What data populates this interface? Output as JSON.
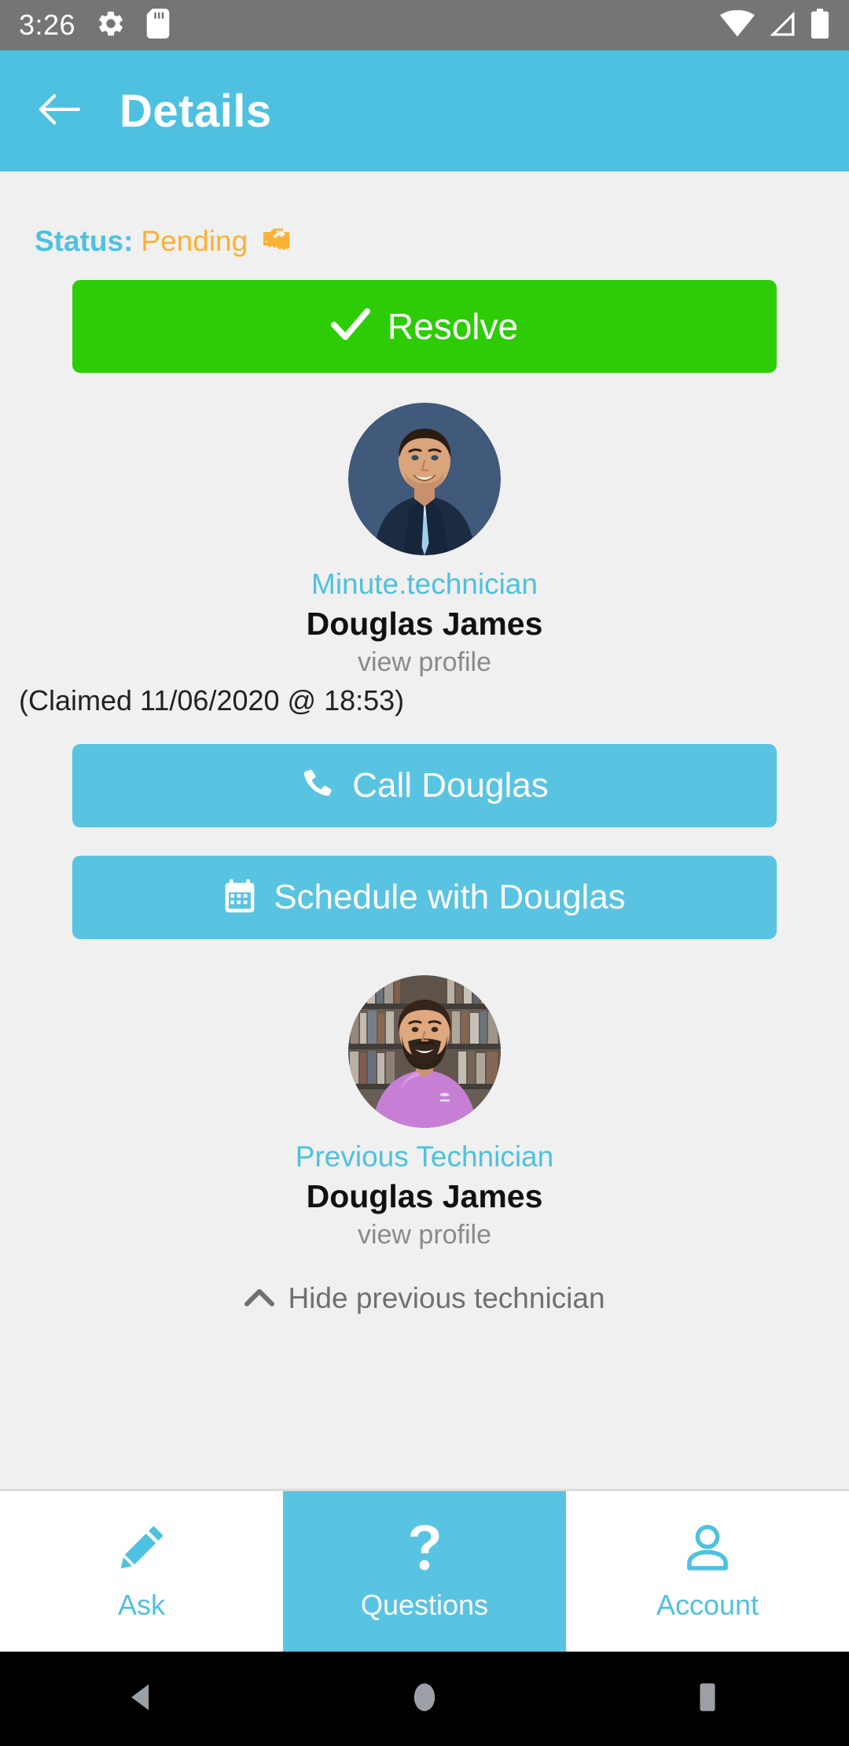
{
  "status_bar": {
    "time": "3:26",
    "left_icons": [
      "gear-icon",
      "sd-card-icon"
    ],
    "right_icons": [
      "wifi-icon",
      "cellular-signal-icon",
      "battery-icon"
    ]
  },
  "header": {
    "title": "Details",
    "back_icon": "arrow-left-icon",
    "background_color": "#4ec1e0"
  },
  "ticket": {
    "status_label": "Status:",
    "status_value": "Pending",
    "status_icon": "handshake-icon",
    "status_label_color": "#4ec1e0",
    "status_value_color": "#f9b233"
  },
  "resolve_button": {
    "label": "Resolve",
    "icon": "check-icon",
    "color": "#2ecc06"
  },
  "current_technician": {
    "role": "Minute.technician",
    "name": "Douglas James",
    "view_profile": "view profile",
    "claimed": "(Claimed 11/06/2020 @ 18:53)",
    "avatar": "avatar-man-in-navy-suit"
  },
  "actions": {
    "call": {
      "label": "Call Douglas",
      "icon": "phone-icon"
    },
    "schedule": {
      "label": "Schedule with Douglas",
      "icon": "calendar-icon"
    }
  },
  "previous_technician": {
    "role": "Previous Technician",
    "name": "Douglas James",
    "view_profile": "view profile",
    "avatar": "avatar-bearded-man-pink-shirt",
    "toggle_label": "Hide previous technician",
    "toggle_icon": "chevron-up-icon"
  },
  "bottom_nav": {
    "accent_color": "#4ec1e0",
    "items": [
      {
        "label": "Ask",
        "icon": "pencil-icon",
        "active": false
      },
      {
        "label": "Questions",
        "icon": "question-mark-icon",
        "active": true
      },
      {
        "label": "Account",
        "icon": "person-icon",
        "active": false
      }
    ]
  },
  "android_nav": {
    "back": "back-triangle-icon",
    "home": "home-circle-icon",
    "recents": "recents-square-icon"
  }
}
